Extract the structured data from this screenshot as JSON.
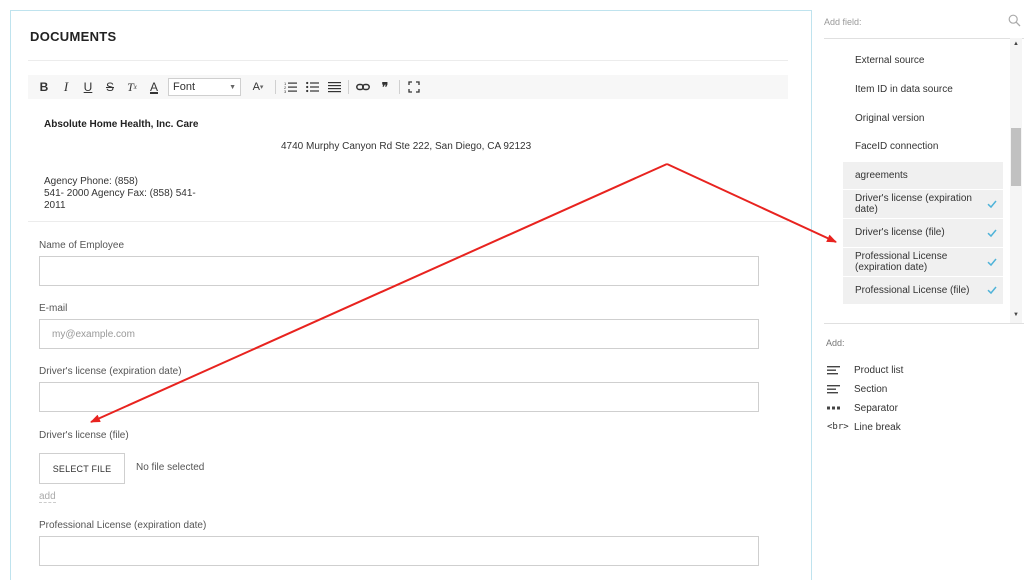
{
  "document": {
    "title": "DOCUMENTS",
    "toolbar": {
      "bold": "B",
      "italic": "I",
      "underline": "U",
      "strike": "S",
      "clear_format": "T",
      "clear_format_sub": "x",
      "font_color": "A",
      "font_select": "Font",
      "font_size": "A",
      "font_size_caret": "▾",
      "quote": "❞"
    },
    "letterhead": {
      "name": "Absolute Home Health, Inc. Care",
      "address": "4740 Murphy Canyon Rd Ste 222, San Diego, CA 92123",
      "phone_line1": "Agency Phone: (858)",
      "phone_line2": "541- 2000 Agency Fax: (858)  541-",
      "phone_line3": "2011"
    },
    "fields": {
      "employee_label": "Name of Employee",
      "employee_value": "",
      "email_label": "E-mail",
      "email_placeholder": "my@example.com",
      "dl_exp_label": "Driver's license (expiration date)",
      "dl_exp_value": "",
      "dl_file_label": "Driver's license (file)",
      "select_file": "SELECT FILE",
      "no_file": "No file selected",
      "add": "add",
      "pl_exp_label": "Professional License (expiration date)",
      "pl_exp_value": ""
    }
  },
  "sidebar": {
    "search_placeholder": "Add field:",
    "fields": [
      {
        "label": "External source",
        "checked": false,
        "highlight": false
      },
      {
        "label": "Item ID in data source",
        "checked": false,
        "highlight": false
      },
      {
        "label": "Original version",
        "checked": false,
        "highlight": false
      },
      {
        "label": "FaceID connection",
        "checked": false,
        "highlight": false
      },
      {
        "label": "agreements",
        "checked": false,
        "highlight": true
      },
      {
        "label": "Driver's license (expiration date)",
        "checked": true,
        "highlight": true
      },
      {
        "label": "Driver's license (file)",
        "checked": true,
        "highlight": true
      },
      {
        "label": "Professional License (expiration date)",
        "checked": true,
        "highlight": true
      },
      {
        "label": "Professional License (file)",
        "checked": true,
        "highlight": true
      }
    ],
    "add_title": "Add:",
    "add_items": [
      {
        "label": "Product list",
        "icon": "lines-icon"
      },
      {
        "label": "Section",
        "icon": "lines-icon"
      },
      {
        "label": "Separator",
        "icon": "dots-icon"
      },
      {
        "label": "Line break",
        "icon": "br-icon",
        "icon_text": "<br>"
      }
    ]
  },
  "colors": {
    "arrow": "#e8231f",
    "check": "#4fb3d9",
    "panel_border": "#bfe3ee"
  }
}
